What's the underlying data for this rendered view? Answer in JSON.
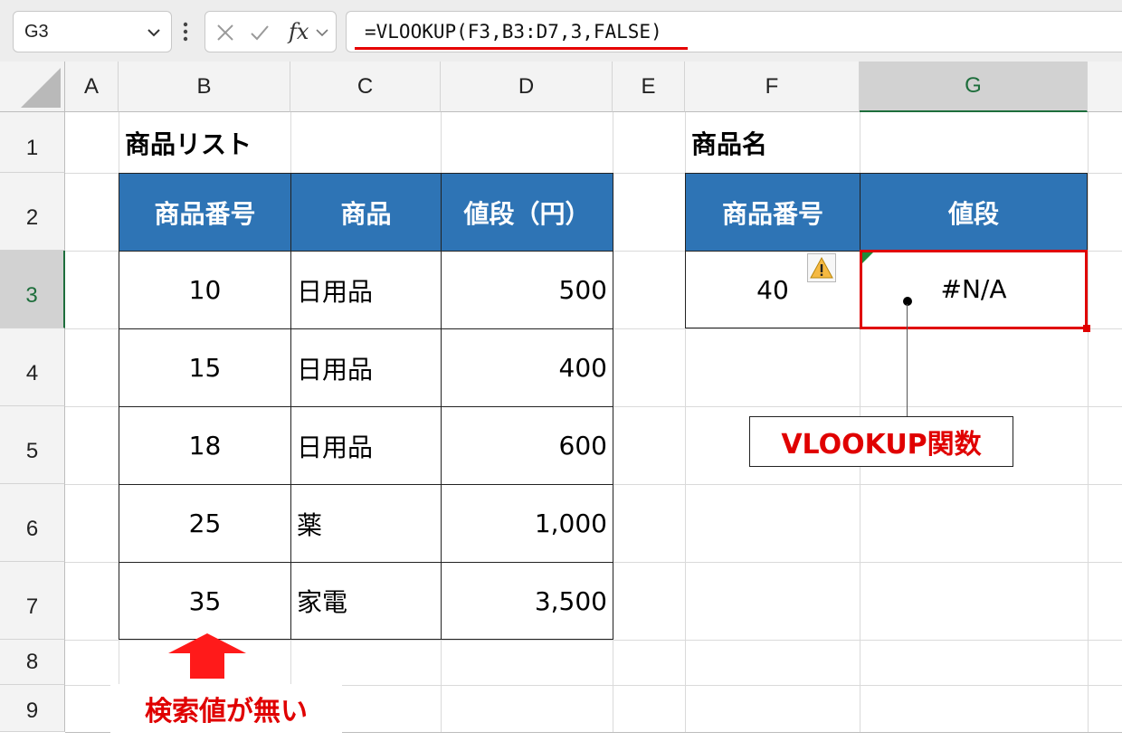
{
  "formula_bar": {
    "name_box": "G3",
    "formula": "=VLOOKUP(F3,B3:D7,3,FALSE)",
    "fx_label": "fx",
    "icons": {
      "cancel": "x-icon",
      "enter": "check-icon",
      "dropdown": "chevron-down-icon",
      "more": "vertical-dots-icon"
    }
  },
  "columns": [
    "A",
    "B",
    "C",
    "D",
    "E",
    "F",
    "G"
  ],
  "selected_column": "G",
  "rows": [
    "1",
    "2",
    "3",
    "4",
    "5",
    "6",
    "7",
    "8",
    "9"
  ],
  "selected_row": "3",
  "product_list": {
    "title": "商品リスト",
    "headers": [
      "商品番号",
      "商品",
      "値段（円）"
    ],
    "rows": [
      [
        "10",
        "日用品",
        "500"
      ],
      [
        "15",
        "日用品",
        "400"
      ],
      [
        "18",
        "日用品",
        "600"
      ],
      [
        "25",
        "薬",
        "1,000"
      ],
      [
        "35",
        "家電",
        "3,500"
      ]
    ]
  },
  "lookup": {
    "title": "商品名",
    "headers": [
      "商品番号",
      "値段"
    ],
    "value": "40",
    "result": "#N/A"
  },
  "annotations": {
    "callout": "VLOOKUP関数",
    "note": "検索値が無い",
    "accent_color": "#e00000",
    "header_color": "#2e74b5"
  }
}
